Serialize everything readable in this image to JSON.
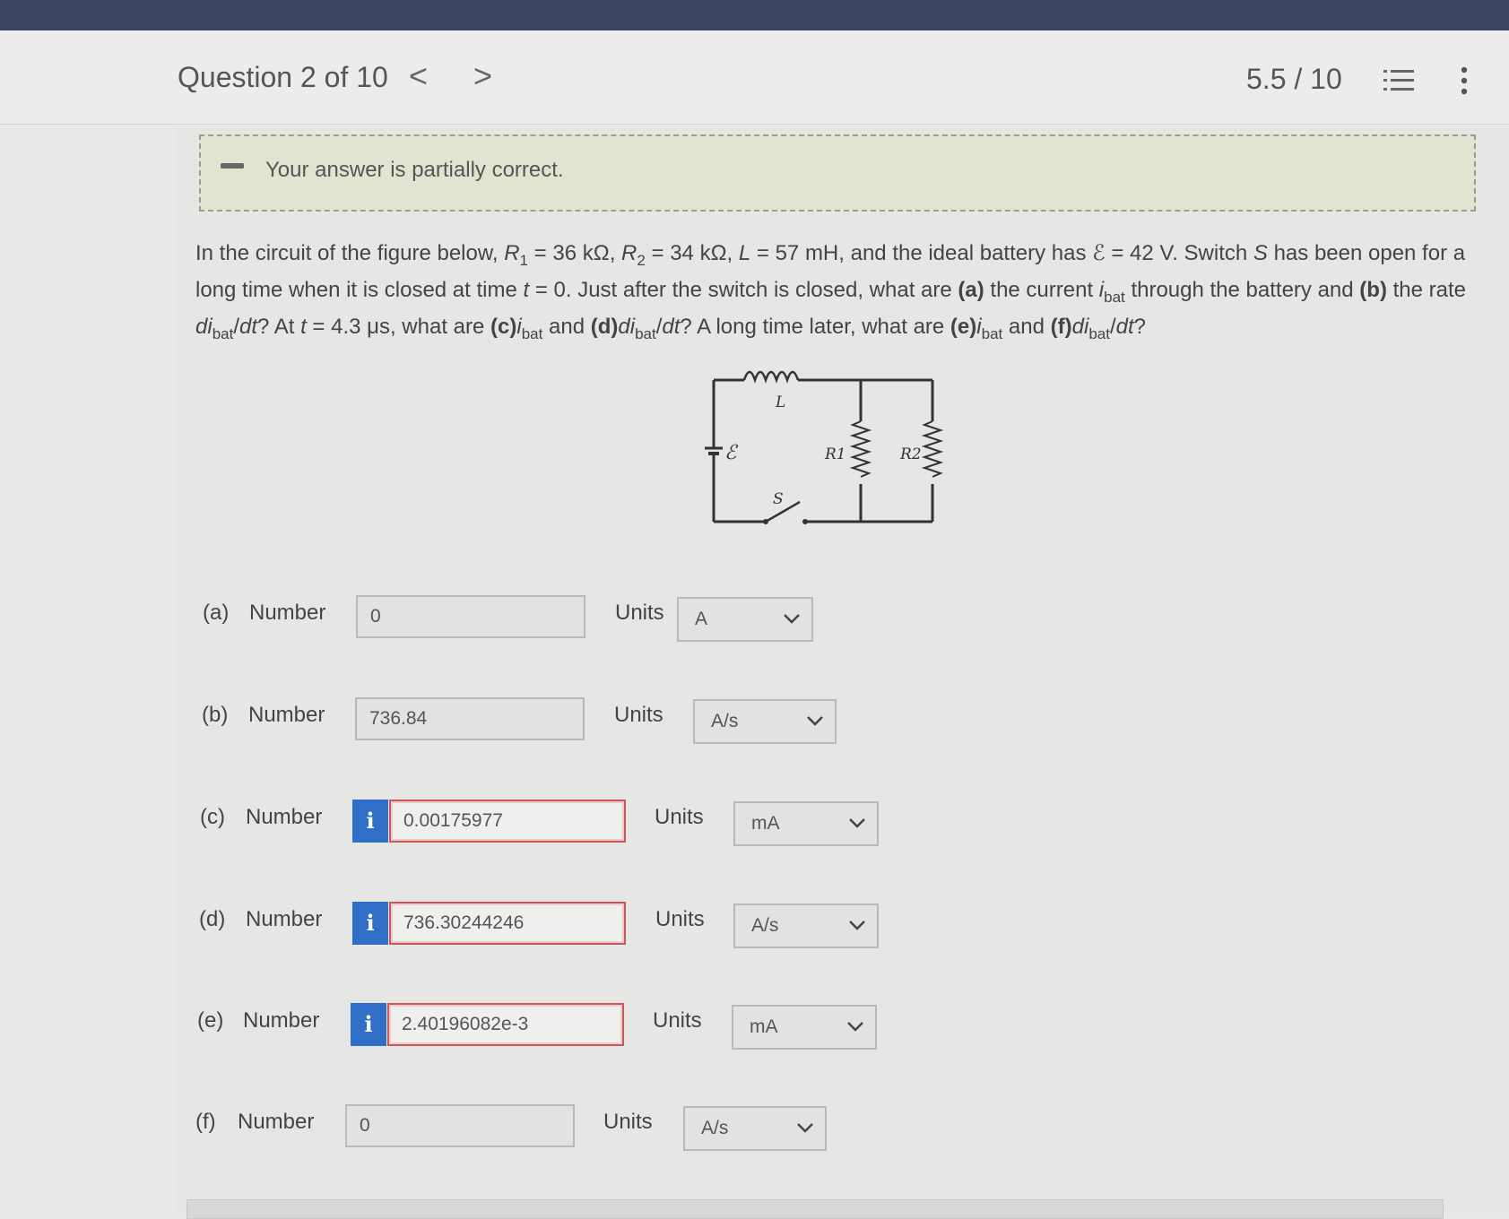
{
  "header": {
    "question_label": "Question 2 of 10",
    "prev_label": "<",
    "next_label": ">",
    "score": "5.5 / 10"
  },
  "banner": {
    "text": "Your answer is partially correct."
  },
  "question": {
    "given": {
      "R1": "36 kΩ",
      "R2": "34 kΩ",
      "L": "57 mH",
      "emf": "42 V",
      "t1": "4.3 μs"
    }
  },
  "figure": {
    "inductor_label": "L",
    "emf_label": "ℰ",
    "r1_label": "R1",
    "r2_label": "R2",
    "switch_label": "S"
  },
  "answers": [
    {
      "part": "(a)",
      "number_label": "Number",
      "value": "0",
      "units_label": "Units",
      "unit": "A",
      "has_info": false,
      "status": "neutral"
    },
    {
      "part": "(b)",
      "number_label": "Number",
      "value": "736.84",
      "units_label": "Units",
      "unit": "A/s",
      "has_info": false,
      "status": "neutral"
    },
    {
      "part": "(c)",
      "number_label": "Number",
      "value": "0.00175977",
      "units_label": "Units",
      "unit": "mA",
      "has_info": true,
      "status": "incorrect"
    },
    {
      "part": "(d)",
      "number_label": "Number",
      "value": "736.30244246",
      "units_label": "Units",
      "unit": "A/s",
      "has_info": true,
      "status": "incorrect"
    },
    {
      "part": "(e)",
      "number_label": "Number",
      "value": "2.40196082e-3",
      "units_label": "Units",
      "unit": "mA",
      "has_info": true,
      "status": "incorrect"
    },
    {
      "part": "(f)",
      "number_label": "Number",
      "value": "0",
      "units_label": "Units",
      "unit": "A/s",
      "has_info": false,
      "status": "neutral"
    }
  ],
  "icons": {
    "info": "i",
    "list": "list-icon",
    "more": "more-vertical-icon",
    "dropdown": "chevron-down-icon"
  },
  "colors": {
    "topbar": "#3a4460",
    "info_button": "#2f6fc7",
    "incorrect_border": "#c65a5a",
    "banner_bg": "#e2e4d2"
  }
}
